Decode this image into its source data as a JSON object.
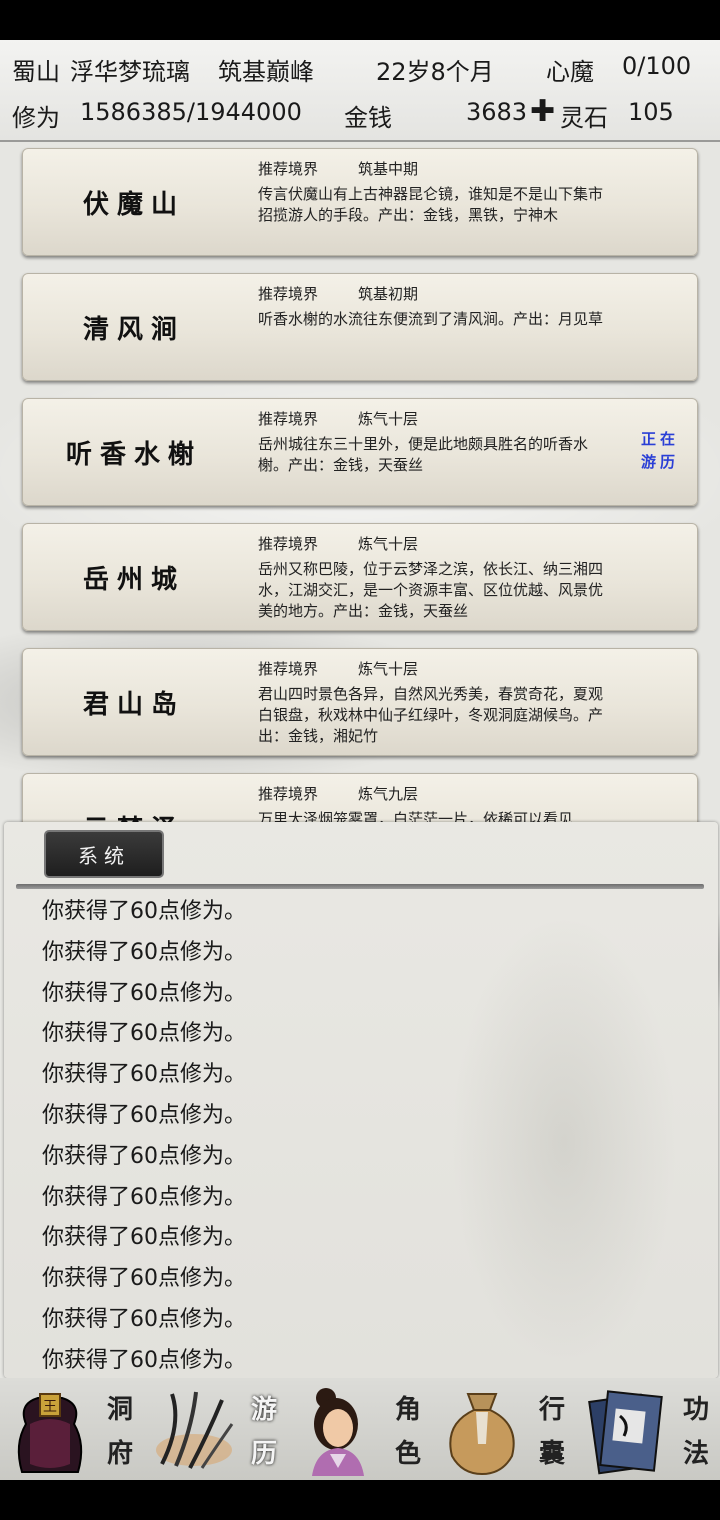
{
  "header": {
    "sect": "蜀山",
    "name": "浮华梦琉璃",
    "realm": "筑基巅峰",
    "age": "22岁8个月",
    "heart_demon_label": "心魔",
    "heart_demon_value": "0/100",
    "cultivation_label": "修为",
    "cultivation_value": "1586385/1944000",
    "money_label": "金钱",
    "money_value": "3683",
    "plus_symbol": "✚",
    "spirit_stone_label": "灵石",
    "spirit_stone_value": "105"
  },
  "locations": [
    {
      "name": "伏魔山",
      "realm_label": "推荐境界",
      "realm": "筑基中期",
      "desc": "传言伏魔山有上古神器昆仑镜，谁知是不是山下集市招揽游人的手段。产出：金钱，黑铁，宁神木",
      "status": ""
    },
    {
      "name": "清风涧",
      "realm_label": "推荐境界",
      "realm": "筑基初期",
      "desc": "听香水榭的水流往东便流到了清风涧。产出：月见草",
      "status": ""
    },
    {
      "name": "听香水榭",
      "realm_label": "推荐境界",
      "realm": "炼气十层",
      "desc": "岳州城往东三十里外，便是此地颇具胜名的听香水榭。产出：金钱，天蚕丝",
      "status": "正在游历"
    },
    {
      "name": "岳州城",
      "realm_label": "推荐境界",
      "realm": "炼气十层",
      "desc": "岳州又称巴陵，位于云梦泽之滨，依长江、纳三湘四水，江湖交汇，是一个资源丰富、区位优越、风景优美的地方。产出：金钱，天蚕丝",
      "status": ""
    },
    {
      "name": "君山岛",
      "realm_label": "推荐境界",
      "realm": "炼气十层",
      "desc": "君山四时景色各异，自然风光秀美，春赏奇花，夏观白银盘，秋戏林中仙子红绿叶，冬观洞庭湖候鸟。产出：金钱，湘妃竹",
      "status": ""
    },
    {
      "name": "云梦泽",
      "realm_label": "推荐境界",
      "realm": "炼气九层",
      "desc": "万里大泽烟笼雾罩，白茫茫一片，依稀可以看见",
      "status": ""
    }
  ],
  "log": {
    "tab_label": "系统",
    "lines": [
      "你获得了60点修为。",
      "你获得了60点修为。",
      "你获得了60点修为。",
      "你获得了60点修为。",
      "你获得了60点修为。",
      "你获得了60点修为。",
      "你获得了60点修为。",
      "你获得了60点修为。",
      "你获得了60点修为。",
      "你获得了60点修为。",
      "你获得了60点修为。",
      "你获得了60点修为。"
    ]
  },
  "nav": {
    "items": [
      {
        "label": "洞府",
        "icon": "cave-residence-icon"
      },
      {
        "label": "游历",
        "icon": "travel-icon"
      },
      {
        "label": "角色",
        "icon": "character-icon"
      },
      {
        "label": "行囊",
        "icon": "bag-icon"
      },
      {
        "label": "功法",
        "icon": "scripture-icon"
      }
    ],
    "active_index": 1
  },
  "colors": {
    "status_blue": "#2a3fd6",
    "card_bg": "#e9e5da",
    "log_tab_bg": "#2a2a2a"
  }
}
